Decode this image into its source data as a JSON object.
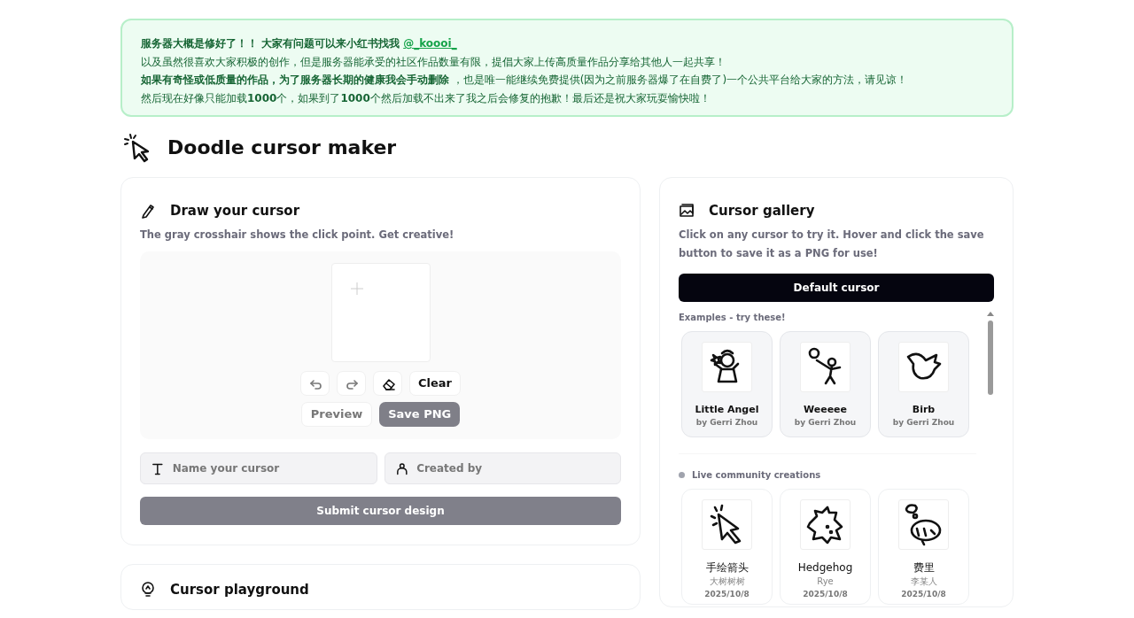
{
  "notice": {
    "lines": [
      {
        "text": "服务器大概是修好了！！ 大家有问题可以来小红书找我",
        "bold": true,
        "link": "@_koooi_"
      },
      {
        "text": "以及虽然很喜欢大家积极的创作，但是服务器能承受的社区作品数量有限，提倡大家上传高质量作品分享给其他人一起共享！",
        "bold": false
      },
      {
        "text": "**如果有奇怪或低质量的作品，为了服务器长期的健康我会手动删除** ，也是唯一能继续免费提供(因为之前服务器爆了在自费了)一个公共平台给大家的方法，请见谅！",
        "bold": false
      },
      {
        "text": "然后现在好像只能加载**1000**个，如果到了**1000**个然后加载不出来了我之后会修复的抱歉！最后还是祝大家玩耍愉快啦！",
        "bold": false
      }
    ]
  },
  "title": "Doodle cursor maker",
  "draw": {
    "heading": "Draw your cursor",
    "hint": "The gray crosshair shows the click point. Get creative!",
    "tools": [
      {
        "kind": "undo"
      },
      {
        "kind": "redo"
      },
      {
        "kind": "eraser"
      }
    ],
    "clear_button": "Clear",
    "preview_button": "Preview",
    "save_button": "Save PNG",
    "name_field": {
      "placeholder": "Name your cursor"
    },
    "creator_field": {
      "placeholder": "Created by"
    },
    "submit_button": "Submit cursor design"
  },
  "gallery": {
    "heading": "Cursor gallery",
    "hint": "Click on any cursor to try it. Hover and click the save button to save it as a PNG for use!",
    "default_button": "Default cursor",
    "examples_label": "Examples - try these!",
    "examples": [
      {
        "kind": "angel",
        "name": "Little Angel",
        "author": "by Gerri Zhou"
      },
      {
        "kind": "stickman",
        "name": "Weeeee",
        "author": "by Gerri Zhou"
      },
      {
        "kind": "bird",
        "name": "Birb",
        "author": "by Gerri Zhou"
      }
    ],
    "community_label": "Live community creations",
    "community": [
      {
        "kind": "arrow",
        "name": "手绘箭头",
        "author": "大树树树",
        "date": "2025/10/8"
      },
      {
        "kind": "hedgehog",
        "name": "Hedgehog",
        "author": "Rye",
        "date": "2025/10/8"
      },
      {
        "kind": "sleeper",
        "name": "费里",
        "author": "李某人",
        "date": "2025/10/8"
      }
    ]
  },
  "playground": {
    "heading": "Cursor playground"
  }
}
